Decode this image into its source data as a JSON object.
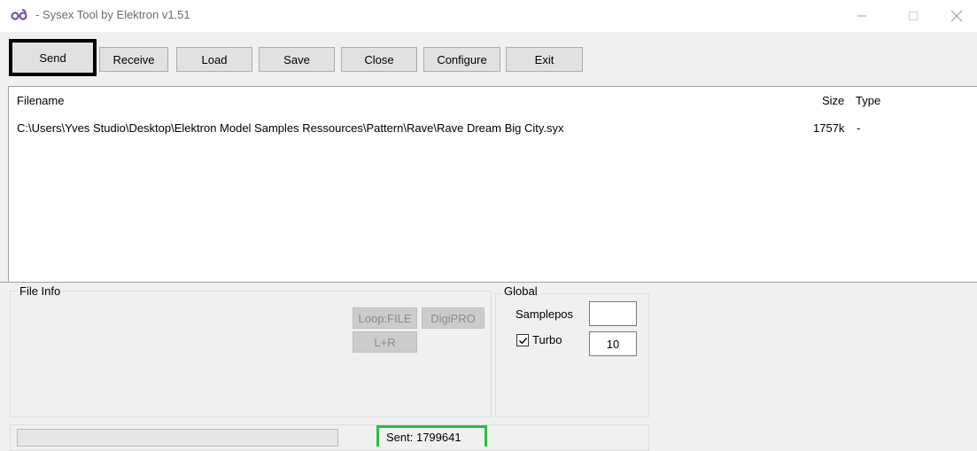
{
  "window": {
    "title": "- Sysex Tool by Elektron v1.51",
    "controls": [
      "minimize-icon",
      "maximize-icon",
      "close-icon"
    ]
  },
  "toolbar": {
    "send": "Send",
    "receive": "Receive",
    "load": "Load",
    "save": "Save",
    "close": "Close",
    "configure": "Configure",
    "exit": "Exit"
  },
  "file_list": {
    "columns": {
      "filename": "Filename",
      "size": "Size",
      "type": "Type"
    },
    "rows": [
      {
        "filename": "C:\\Users\\Yves Studio\\Desktop\\Elektron Model Samples Ressources\\Pattern\\Rave\\Rave Dream Big City.syx",
        "size": "1757k",
        "type": "-"
      }
    ]
  },
  "file_info": {
    "title": "File Info",
    "loop_file": "Loop:FILE",
    "digipro": "DigiPRO",
    "lr": "L+R"
  },
  "global": {
    "title": "Global",
    "samplepos_label": "Samplepos",
    "samplepos_value": "",
    "turbo_label": "Turbo",
    "turbo_checked": true,
    "turbo_value": "10"
  },
  "status": {
    "progress_percent": 0,
    "sent": "Sent: 1799641"
  },
  "colors": {
    "focus_border": "#000000",
    "sent_highlight": "#22c33a",
    "app_icon": "#7a4fa0"
  }
}
